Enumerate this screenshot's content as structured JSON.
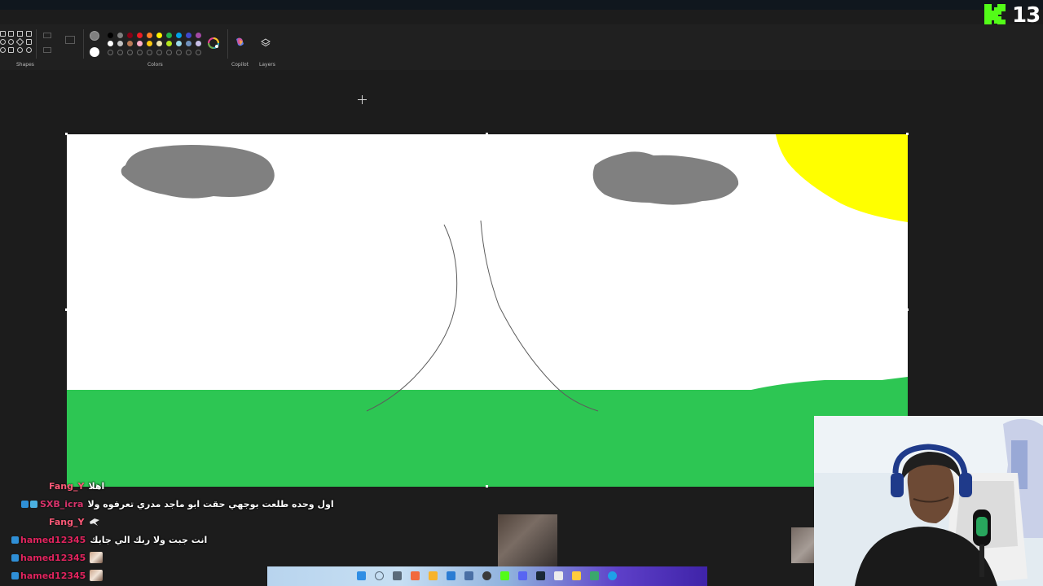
{
  "kick": {
    "viewer_count": "13"
  },
  "ribbon": {
    "groups": [
      {
        "label": "Shapes"
      },
      {
        "label": "Colors"
      },
      {
        "label": "Copilot"
      },
      {
        "label": "Layers"
      }
    ],
    "palette_row1": [
      "#000000",
      "#7f7f7f",
      "#880015",
      "#ed1c24",
      "#ff7f27",
      "#fff200",
      "#22b14c",
      "#00a2e8",
      "#3f48cc",
      "#a349a4"
    ],
    "palette_row2": [
      "#ffffff",
      "#c3c3c3",
      "#b97a57",
      "#ffaec9",
      "#ffc90e",
      "#efe4b0",
      "#b5e61d",
      "#99d9ea",
      "#7092be",
      "#c8bfe7"
    ],
    "primary_color": "#7f7f7f",
    "secondary_color": "#ffffff"
  },
  "canvas": {
    "background": "#ffffff",
    "sky_color": "#ffffff",
    "grass_color": "#2dc653",
    "sun_color": "#ffff00",
    "cloud_color": "#808080"
  },
  "chat": {
    "messages": [
      {
        "user": "Fang_Y",
        "user_color": "#ff5a78",
        "text": "اهلا",
        "badges": 0,
        "emote": false
      },
      {
        "user": "SXB_icra",
        "user_color": "#d8336b",
        "text": "اول وحده طلعت بوجهي حقت ابو ماجد مدري تعرفوه ولا",
        "badges": 2,
        "emote": false
      },
      {
        "user": "Fang_Y",
        "user_color": "#ff5a78",
        "text": "",
        "badges": 0,
        "emote": true
      },
      {
        "user": "hamed12345",
        "user_color": "#e0245e",
        "text": "انت جبت ولا ربك الي جابك",
        "badges": 1,
        "emote": false
      },
      {
        "user": "hamed12345",
        "user_color": "#e0245e",
        "text": "",
        "badges": 1,
        "emote": true
      },
      {
        "user": "hamed12345",
        "user_color": "#e0245e",
        "text": "",
        "badges": 1,
        "emote": true
      }
    ]
  }
}
